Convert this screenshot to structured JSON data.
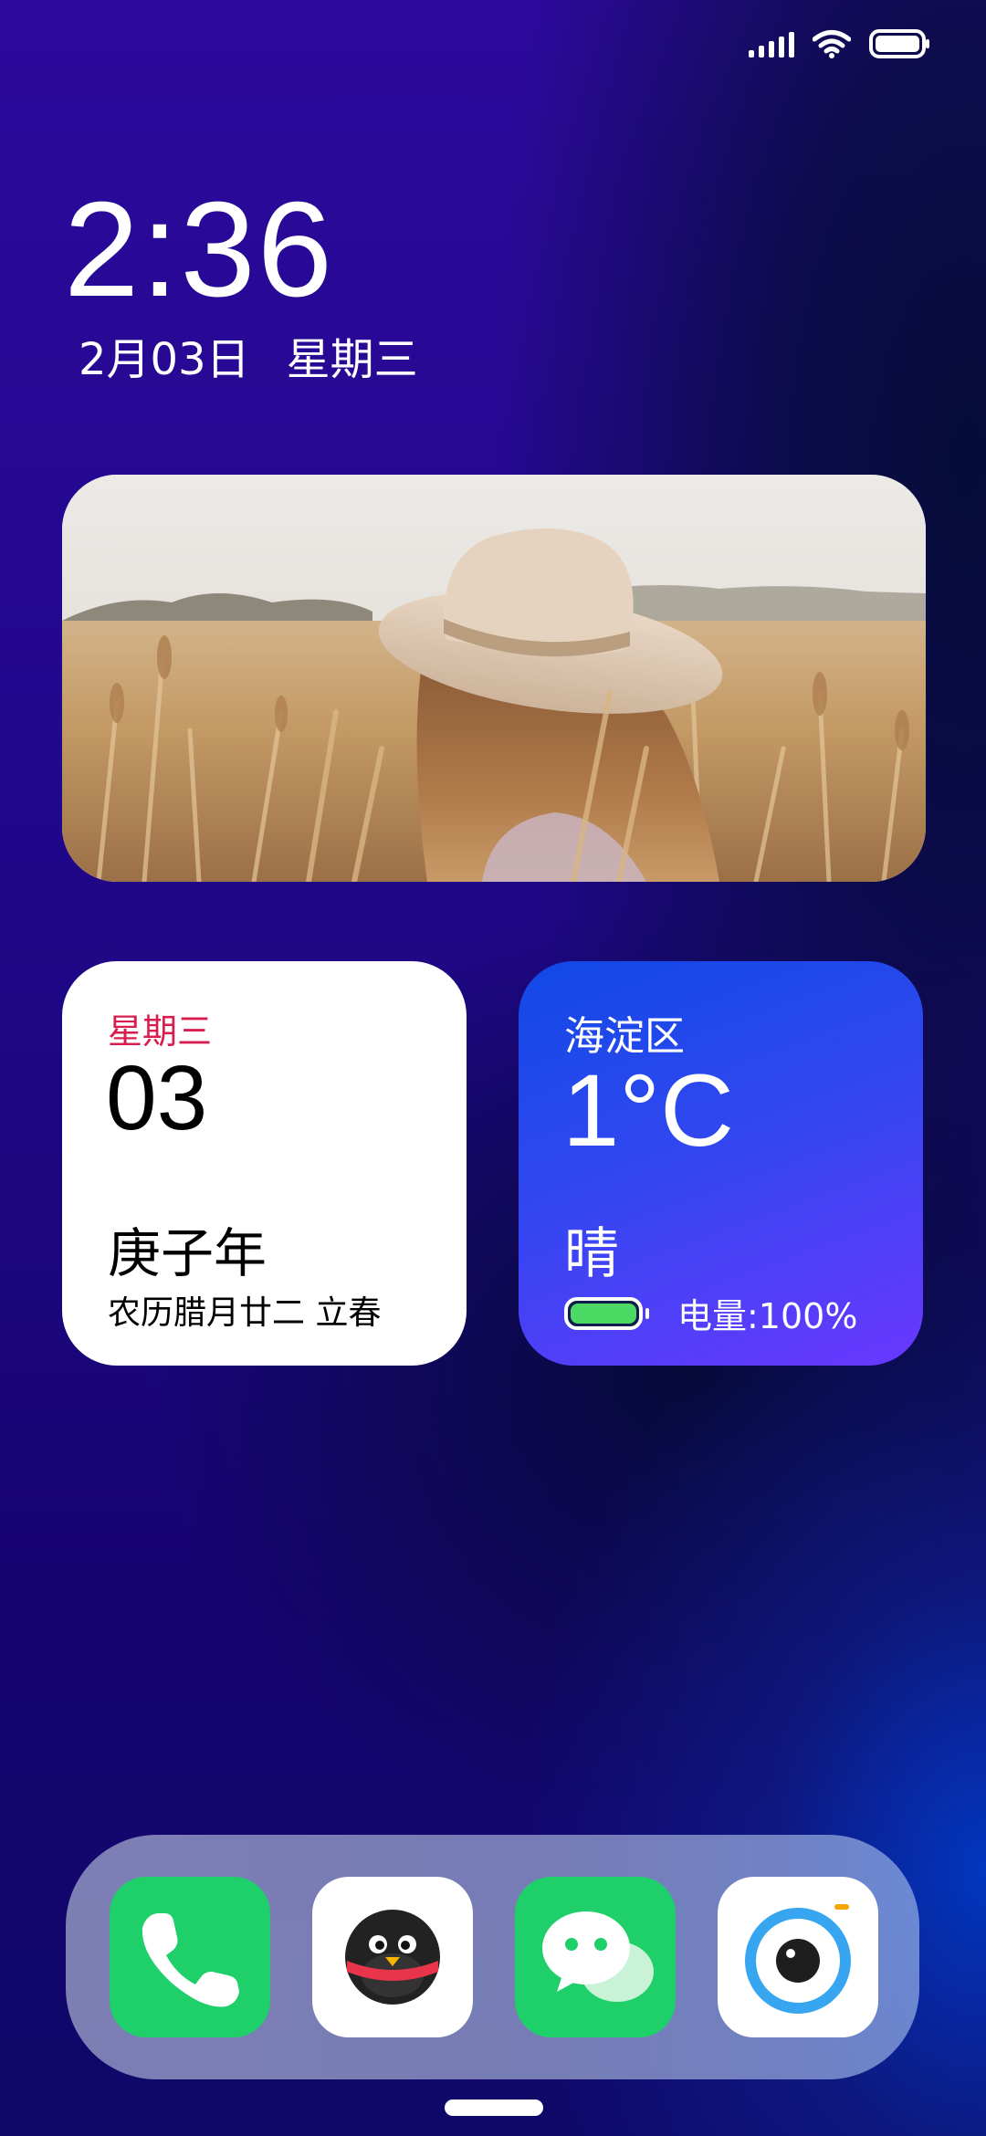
{
  "status_bar": {
    "signal_icon": "signal-icon",
    "wifi_icon": "wifi-icon",
    "battery_icon": "battery-icon",
    "battery_level": 1.0
  },
  "lockscreen": {
    "time": "2:36",
    "date": "2月03日",
    "weekday": "星期三"
  },
  "photo_widget": {
    "subject": "woman in sun hat in wheat field"
  },
  "calendar_widget": {
    "weekday": "星期三",
    "day": "03",
    "year_name": "庚子年",
    "lunar_date": "农历腊月廿二 立春",
    "weekday_color": "#d81e4f"
  },
  "weather_widget": {
    "location": "海淀区",
    "temperature": "1°C",
    "condition": "晴",
    "battery_text": "电量:100%",
    "battery_level": 1.0,
    "battery_color": "#4cd964"
  },
  "dock": {
    "apps": [
      {
        "icon": "phone-icon",
        "background": "#1fcf6a"
      },
      {
        "icon": "qq-icon",
        "background": "#ffffff"
      },
      {
        "icon": "wechat-icon",
        "background": "#1fcf6a"
      },
      {
        "icon": "camera-icon",
        "background": "#ffffff"
      }
    ]
  }
}
